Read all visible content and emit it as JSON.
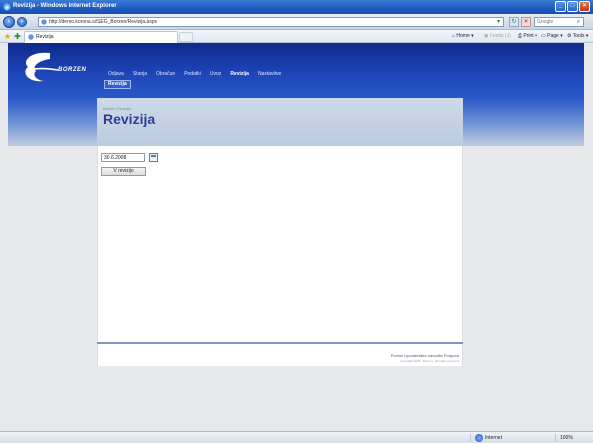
{
  "window": {
    "title": "Revizija - Windows Internet Explorer",
    "url": "http://demo.korona.si/SEG_Borzen/Revizija.aspx"
  },
  "search": {
    "placeholder": "Google"
  },
  "tabs": [
    {
      "label": "Revizija"
    }
  ],
  "commands": {
    "home": "Home",
    "feeds": "Feeds (J)",
    "print": "Print",
    "page": "Page",
    "tools": "Tools"
  },
  "site": {
    "logo_text": "BORZEN",
    "nav": [
      {
        "label": "Odjava",
        "active": false
      },
      {
        "label": "Stanja",
        "active": false
      },
      {
        "label": "Obračun",
        "active": false
      },
      {
        "label": "Podatki",
        "active": false
      },
      {
        "label": "Uvoz",
        "active": false
      },
      {
        "label": "Revizija",
        "active": true
      },
      {
        "label": "Nastavitve",
        "active": false
      }
    ],
    "subnav_active": "Revizija",
    "breadcrumb": "Borzen Revizija",
    "page_title": "Revizija"
  },
  "form": {
    "date_value": "30.6.2008",
    "submit_label": "V revizijo"
  },
  "footer": {
    "links": "Pomoč  Uporabniško navodilo  Podpora",
    "copyright": "Copyright 2008 - Borzen - All rights reserved"
  },
  "status": {
    "zone": "Internet",
    "zoom": "100%"
  },
  "colors": {
    "brand_blue": "#1d45b8",
    "title_blue": "#2c3f92"
  }
}
